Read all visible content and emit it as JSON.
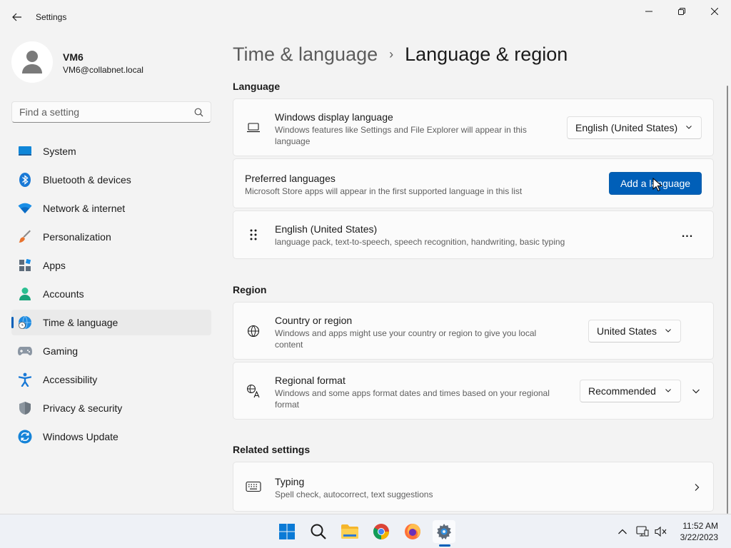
{
  "window": {
    "title": "Settings"
  },
  "user": {
    "name": "VM6",
    "email": "VM6@collabnet.local"
  },
  "search": {
    "placeholder": "Find a setting"
  },
  "sidebar": {
    "items": [
      {
        "label": "System",
        "icon": "system-icon"
      },
      {
        "label": "Bluetooth & devices",
        "icon": "bluetooth-icon"
      },
      {
        "label": "Network & internet",
        "icon": "wifi-icon"
      },
      {
        "label": "Personalization",
        "icon": "brush-icon"
      },
      {
        "label": "Apps",
        "icon": "apps-icon"
      },
      {
        "label": "Accounts",
        "icon": "accounts-icon"
      },
      {
        "label": "Time & language",
        "icon": "globe-clock-icon",
        "selected": true
      },
      {
        "label": "Gaming",
        "icon": "gamepad-icon"
      },
      {
        "label": "Accessibility",
        "icon": "accessibility-icon"
      },
      {
        "label": "Privacy & security",
        "icon": "shield-icon"
      },
      {
        "label": "Windows Update",
        "icon": "update-icon"
      }
    ]
  },
  "breadcrumb": {
    "parent": "Time & language",
    "separator": "›",
    "current": "Language & region"
  },
  "language": {
    "section_title": "Language",
    "display": {
      "title": "Windows display language",
      "desc": "Windows features like Settings and File Explorer will appear in this language",
      "value": "English (United States)"
    },
    "preferred": {
      "title": "Preferred languages",
      "desc": "Microsoft Store apps will appear in the first supported language in this list",
      "button": "Add a language"
    },
    "installed": {
      "title": "English (United States)",
      "desc": "language pack, text-to-speech, speech recognition, handwriting, basic typing",
      "more": "..."
    }
  },
  "region": {
    "section_title": "Region",
    "country": {
      "title": "Country or region",
      "desc": "Windows and apps might use your country or region to give you local content",
      "value": "United States"
    },
    "format": {
      "title": "Regional format",
      "desc": "Windows and some apps format dates and times based on your regional format",
      "value": "Recommended"
    }
  },
  "related": {
    "section_title": "Related settings",
    "typing": {
      "title": "Typing",
      "desc": "Spell check, autocorrect, text suggestions"
    }
  },
  "taskbar": {
    "time": "11:52 AM",
    "date": "3/22/2023"
  },
  "colors": {
    "accent": "#005fb8",
    "background": "#f3f3f3",
    "card": "#fbfbfb"
  }
}
